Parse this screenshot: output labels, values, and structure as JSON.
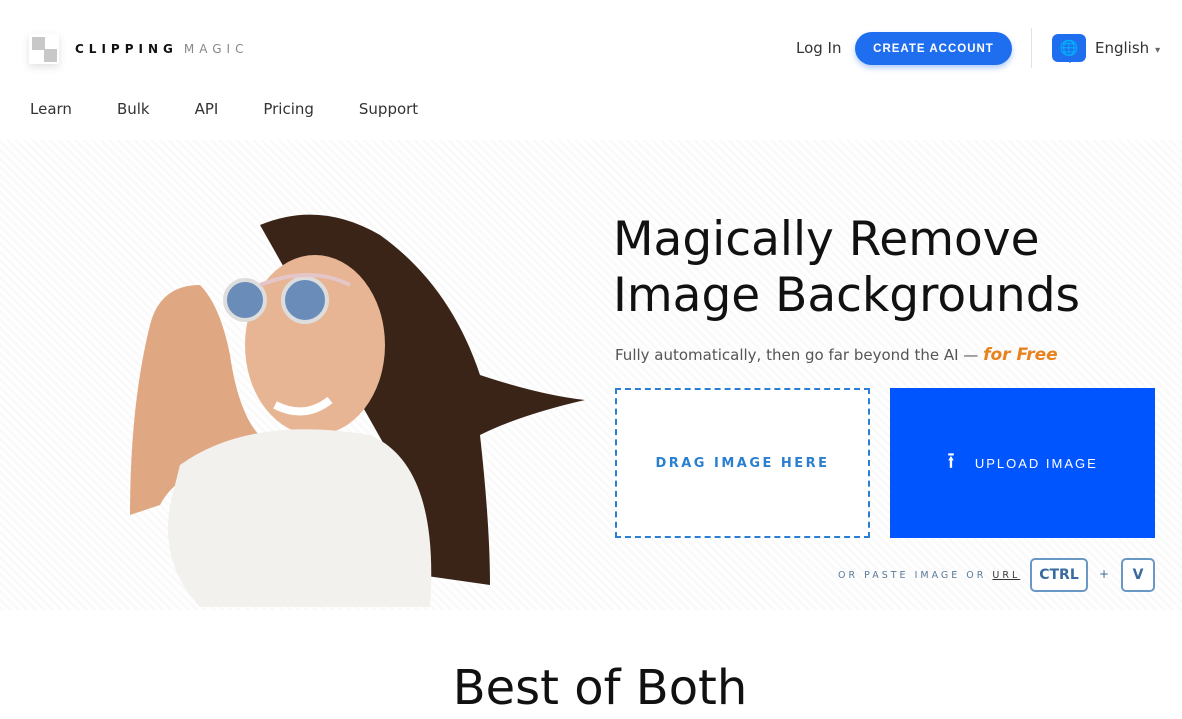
{
  "header": {
    "logo_bold": "CLIPPING",
    "logo_light": "MAGIC",
    "login": "Log In",
    "create_account": "CREATE ACCOUNT",
    "language": "English",
    "globe_icon": "globe-icon",
    "accent": "#1f6ef0"
  },
  "nav": [
    "Learn",
    "Bulk",
    "API",
    "Pricing",
    "Support"
  ],
  "hero": {
    "title_line1": "Magically Remove",
    "title_line2": "Image Backgrounds",
    "subtitle": "Fully automatically, then go far beyond the AI —",
    "subtitle_highlight": "for Free",
    "drag": "DRAG IMAGE HERE",
    "upload": "UPLOAD IMAGE",
    "paste_prefix": "OR PASTE IMAGE OR",
    "paste_url": "URL",
    "key_ctrl": "CTRL",
    "key_plus": "+",
    "key_v": "V"
  },
  "section": {
    "title": "Best of Both"
  }
}
